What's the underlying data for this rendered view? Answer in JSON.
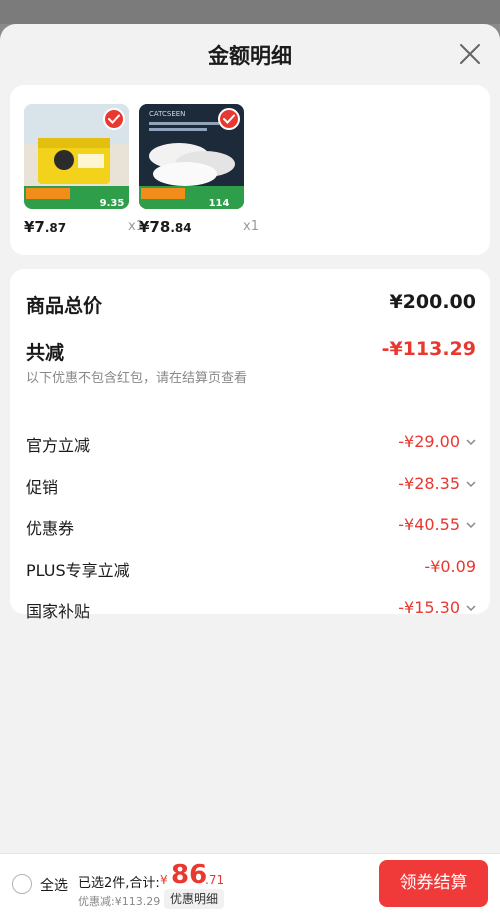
{
  "sheet": {
    "title": "金额明细"
  },
  "products": [
    {
      "price_int": "¥7",
      "price_dec": ".87",
      "qty": "x1",
      "promo": "9.35",
      "brand": ""
    },
    {
      "price_int": "¥78",
      "price_dec": ".84",
      "qty": "x1",
      "promo": "114",
      "brand": "CATCSEEN"
    }
  ],
  "breakdown": {
    "total_label": "商品总价",
    "total_value": "¥200.00",
    "reduce_label": "共减",
    "reduce_value": "-¥113.29",
    "reduce_note": "以下优惠不包含红包，请在结算页查看",
    "items": [
      {
        "label": "官方立减",
        "value": "-¥29.00",
        "expandable": true
      },
      {
        "label": "促销",
        "value": "-¥28.35",
        "expandable": true
      },
      {
        "label": "优惠券",
        "value": "-¥40.55",
        "expandable": true
      },
      {
        "label": "PLUS专享立减",
        "value": "-¥0.09",
        "expandable": false
      },
      {
        "label": "国家补贴",
        "value": "-¥15.30",
        "expandable": true
      }
    ]
  },
  "footer": {
    "select_all": "全选",
    "summary_label": "已选2件,合计:",
    "sum_yen": "¥",
    "sum_int": "86",
    "sum_dec": ".71",
    "discount_text": "优惠减:¥113.29",
    "detail_chip": "优惠明细",
    "checkout_label": "领券结算"
  },
  "colors": {
    "accent": "#e8382f",
    "checkout": "#f03a3a"
  }
}
